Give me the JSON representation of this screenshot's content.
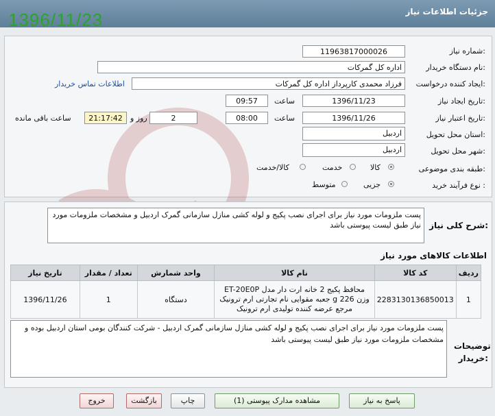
{
  "header": {
    "title": "جزئیات اطلاعات نیاز",
    "date_stamp": "1396/11/23"
  },
  "form": {
    "need_number": {
      "label": "شماره نیاز:",
      "value": "11963817000026"
    },
    "buyer_org": {
      "label": "نام دستگاه خریدار:",
      "value": "اداره کل گمرکات"
    },
    "requester": {
      "label": "ایجاد کننده درخواست:",
      "value": "فرزاد محمدی کارپرداز اداره کل گمرکات",
      "contact_link": "اطلاعات تماس خریدار"
    },
    "created": {
      "label": "تاریخ ایجاد نیاز:",
      "date": "1396/11/23",
      "time_label": "ساعت",
      "time": "09:57"
    },
    "validity": {
      "label": "تاریخ اعتبار نیاز:",
      "date": "1396/11/26",
      "time_label": "ساعت",
      "time": "08:00",
      "days": "2",
      "days_label": "روز و",
      "remaining": "21:17:42",
      "remaining_label": "ساعت باقی مانده"
    },
    "province": {
      "label": "استان محل تحویل:",
      "value": "اردبیل"
    },
    "city": {
      "label": "شهر محل تحویل:",
      "value": "اردبیل"
    },
    "category": {
      "label": "طبقه بندی موضوعی:",
      "options": [
        "کالا",
        "خدمت",
        "کالا/خدمت"
      ],
      "selected": "کالا"
    },
    "process": {
      "label": "نوع فرآیند خرید :",
      "options": [
        "جزیی",
        "متوسط"
      ],
      "selected": "جزیی"
    }
  },
  "summary": {
    "label": "شرح کلی نیاز:",
    "text": "پست ملزومات مورد نیاز برای اجرای نصب پکیج و لوله کشی منازل سازمانی گمرک اردبیل  و مشخصات ملزومات مورد نیاز طبق لیست پیوستی باشد"
  },
  "items_section": {
    "title": "اطلاعات کالاهای مورد نیاز",
    "columns": [
      "ردیف",
      "کد کالا",
      "نام کالا",
      "واحد شمارش",
      "تعداد / مقدار",
      "تاریخ نیاز"
    ],
    "rows": [
      {
        "row": "1",
        "code": "2283130136850013",
        "name": "محافظ پکیج 2 خانه ارت دار مدل ET-20E0P وزن 226 g جعبه مقوایی نام تجارتی ارم ترونیک مرجع عرضه کننده تولیدی ارم ترونیک",
        "unit": "دستگاه",
        "qty": "1",
        "date": "1396/11/26"
      }
    ]
  },
  "buyer_notes": {
    "label": "توضیحات خریدار:",
    "text": "پست ملزومات مورد نیاز برای اجرای نصب پکیج و لوله کشی منازل سازمانی گمرک اردبیل - شرکت کنندگان بومی استان اردبیل بوده و مشخصات ملزومات مورد نیاز طبق لیست پیوستی باشد"
  },
  "buttons": {
    "reply": "پاسخ به نیاز",
    "attachments": "مشاهده مدارک پیوستی (1)",
    "print": "چاپ",
    "back": "بازگشت",
    "exit": "خروج"
  },
  "colors": {
    "header": "#6d8ca5",
    "date_stamp": "#2aa52a",
    "remaining_bg": "#fbf5c8",
    "link": "#1a4fa3"
  }
}
